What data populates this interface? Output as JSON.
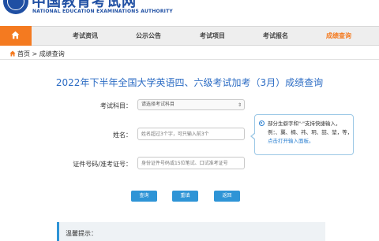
{
  "header": {
    "brand_zh": "中国教育考试网",
    "brand_en": "NATIONAL EDUCATION EXAMINATIONS AUTHORITY"
  },
  "nav": {
    "items": [
      {
        "label": "考试资讯"
      },
      {
        "label": "公示公告"
      },
      {
        "label": "考试项目"
      },
      {
        "label": "考试报名"
      },
      {
        "label": "成绩查询"
      }
    ],
    "active_index": 4,
    "home_icon": "home-icon",
    "active_color": "#f47a20"
  },
  "breadcrumb": {
    "home": "首页",
    "separator": ">",
    "current": "成绩查询"
  },
  "page_title": "2022年下半年全国大学英语四、六级考试加考（3月）成绩查询",
  "form": {
    "subject_label": "考试科目：",
    "subject_value": "请选择考试科目",
    "name_label": "姓名：",
    "name_placeholder": "姓名超过3个字，可只输入前3个",
    "id_label": "证件号码/准考证号：",
    "id_placeholder": "身份证件号码或15位笔试、口试准考证号"
  },
  "tip": {
    "text": "部分生僻字和\"·\"支持快捷输入，例：、龑、楠、祎、玥、喆、堃，等，",
    "link": "点击打开输入面板。"
  },
  "buttons": {
    "query": "查询",
    "reset": "重填",
    "back": "返回"
  },
  "notice": {
    "title": "温馨提示："
  },
  "colors": {
    "brand_blue": "#1f4fa3",
    "title_blue": "#2c6cc4",
    "button_blue": "#2e94d6",
    "orange": "#f47a20"
  }
}
